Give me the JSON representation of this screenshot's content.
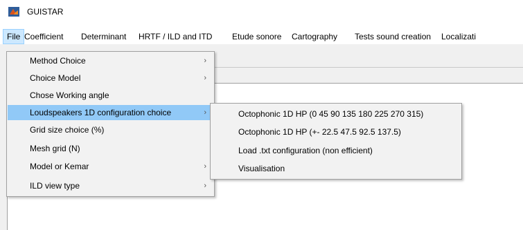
{
  "window": {
    "title": "GUISTAR",
    "icon": "matlab-logo-icon"
  },
  "menubar": {
    "items": [
      {
        "label": "File",
        "active": true
      },
      {
        "label": "Coefficient"
      },
      {
        "label": "Determinant"
      },
      {
        "label": "HRTF / ILD and ITD"
      },
      {
        "label": "Etude sonore"
      },
      {
        "label": "Cartography"
      },
      {
        "label": "Tests sound creation"
      },
      {
        "label": "Localizati"
      }
    ]
  },
  "file_menu": {
    "items": [
      {
        "label": "Method Choice",
        "arrow": "›"
      },
      {
        "label": "Choice Model",
        "arrow": "›"
      },
      {
        "label": "Chose Working angle"
      },
      {
        "label": "Loudspeakers 1D configuration choice",
        "arrow": "›",
        "active": true
      },
      {
        "label": "Grid size choice (%)"
      },
      {
        "label": "Mesh grid (N)"
      },
      {
        "label": "Model or Kemar",
        "arrow": "›"
      },
      {
        "label": "ILD view type",
        "arrow": "›"
      }
    ]
  },
  "submenu": {
    "items": [
      {
        "label": "Octophonic 1D HP (0 45 90 135 180 225 270 315)"
      },
      {
        "label": "Octophonic 1D HP (+- 22.5 47.5 92.5 137.5)"
      },
      {
        "label": "Load .txt configuration (non efficient)"
      },
      {
        "label": "Visualisation"
      }
    ]
  },
  "colors": {
    "highlight": "#91c9f7",
    "menubar_active": "#cce8ff",
    "menu_bg": "#f2f2f2"
  }
}
